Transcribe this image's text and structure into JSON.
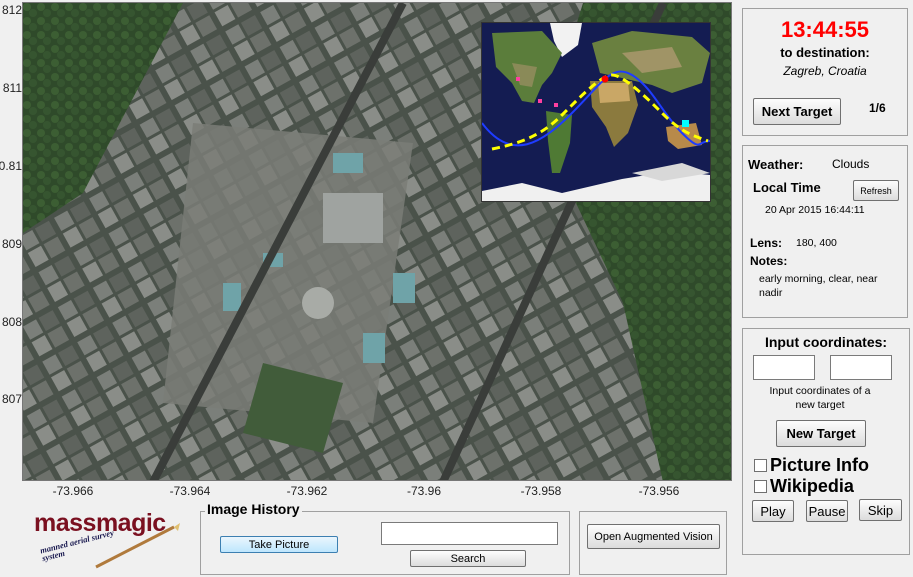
{
  "axes": {
    "y_ticks": [
      "812",
      "811",
      "0.81",
      "809",
      "808",
      "807"
    ],
    "x_ticks": [
      "-73.966",
      "-73.964",
      "-73.962",
      "-73.96",
      "-73.958",
      "-73.956"
    ]
  },
  "timer": {
    "countdown": "13:44:55",
    "to_destination_label": "to destination:",
    "destination": "Zagreb, Croatia",
    "next_target_label": "Next Target",
    "progress": "1/6",
    "countdown_color": "#ff0000"
  },
  "info": {
    "weather_label": "Weather:",
    "weather_value": "Clouds",
    "local_time_label": "Local Time",
    "refresh_label": "Refresh",
    "local_time_value": "20 Apr 2015 16:44:11",
    "lens_label": "Lens:",
    "lens_value": "180, 400",
    "notes_label": "Notes:",
    "notes_value": "early morning, clear, near nadir"
  },
  "coords": {
    "title": "Input coordinates:",
    "lat_value": "",
    "lon_value": "",
    "hint": "Input coordinates of a new target",
    "new_target_label": "New Target",
    "picture_info_label": "Picture Info",
    "wikipedia_label": "Wikipedia",
    "play_label": "Play",
    "pause_label": "Pause",
    "skip_label": "Skip"
  },
  "logo": {
    "text": "massmagic",
    "tagline": "manned aerial survey system"
  },
  "history": {
    "title": "Image History",
    "take_picture_label": "Take Picture",
    "search_value": "",
    "search_label": "Search"
  },
  "augmented": {
    "open_label": "Open Augmented Vision"
  }
}
